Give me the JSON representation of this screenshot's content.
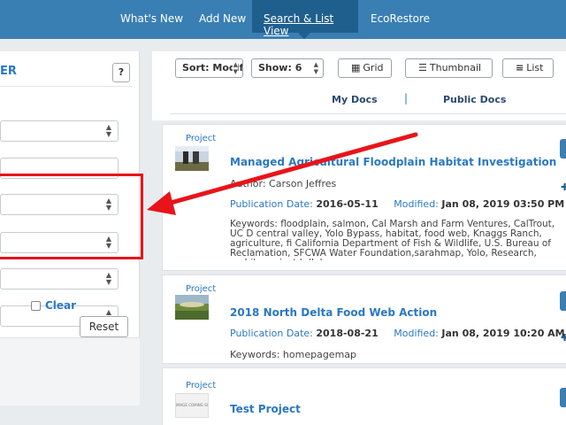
{
  "nav": {
    "items": [
      "What's New",
      "Add New",
      "Search & List View",
      "EcoRestore"
    ],
    "active_index": 2
  },
  "filter_panel": {
    "title": "ER",
    "help_label": "?",
    "clear_label": "Clear",
    "reset_label": "Reset"
  },
  "toolbar": {
    "sort_label": "Sort: Modifi",
    "show_label": "Show: 6",
    "grid_label": "Grid",
    "thumbnail_label": "Thumbnail",
    "list_label": "List",
    "tab_mydocs": "My Docs",
    "tab_separator": "|",
    "tab_public": "Public Docs"
  },
  "results": [
    {
      "type": "Project",
      "title": "Managed Agricultural Floodplain Habitat Investigation",
      "author": "Author: Carson Jeffres",
      "pub_label": "Publication Date:",
      "pub_date": "2016-05-11",
      "mod_label": "Modified:",
      "mod_date": "Jan 08, 2019 03:50 PM",
      "keywords": "Keywords: floodplain, salmon, Cal Marsh and Farm Ventures, CalTrout, UC D central valley, Yolo Bypass, habitat, food web, Knaggs Ranch, agriculture, fi California Department of Fish & Wildlife, U.S. Bureau of Reclamation, SFCWA Water Foundation,sarahmap, Yolo, Research, mobile.project.bdl, homepag"
    },
    {
      "type": "Project",
      "title": "2018 North Delta Food Web Action",
      "pub_label": "Publication Date:",
      "pub_date": "2018-08-21",
      "mod_label": "Modified:",
      "mod_date": "Jan 08, 2019 10:20 AM",
      "keywords": "Keywords: homepagemap"
    },
    {
      "type": "Project",
      "title": "Test Project",
      "thumb_text": "IMAGE COMING SOON"
    }
  ],
  "colors": {
    "nav_bg": "#3a7fb4",
    "nav_active": "#1f5f8e",
    "link_blue": "#2b78c2",
    "annotation_red": "#e8141a"
  }
}
